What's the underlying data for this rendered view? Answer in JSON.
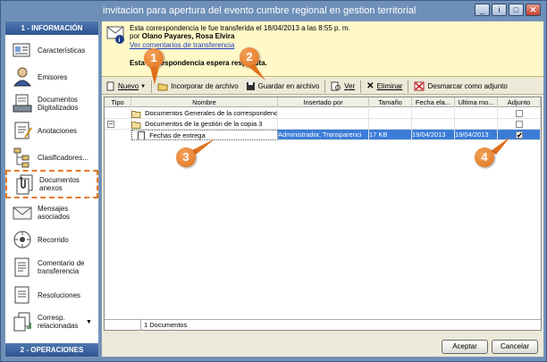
{
  "window": {
    "title": "invitacion para apertura del evento cumbre regional en gestion territorial",
    "buttons": [
      "_",
      "i",
      "□",
      "✕"
    ]
  },
  "sidebar": {
    "header": "1 - INFORMACIÓN",
    "footer": "2 - OPERACIONES",
    "items": [
      {
        "label": "Características",
        "icon": "card-icon"
      },
      {
        "label": "Emisores",
        "icon": "user-icon"
      },
      {
        "label": "Documentos Digitalizados",
        "icon": "scanner-icon"
      },
      {
        "label": "Anotaciones",
        "icon": "notes-icon"
      },
      {
        "label": "Clasificadores...",
        "icon": "tree-icon"
      },
      {
        "label": "Documentos anexos",
        "icon": "attachment-icon"
      },
      {
        "label": "Mensajes asociados",
        "icon": "envelope-icon"
      },
      {
        "label": "Recorrido",
        "icon": "route-icon"
      },
      {
        "label": "Comentario de transferencia",
        "icon": "comment-icon"
      },
      {
        "label": "Resoluciones",
        "icon": "resolution-icon"
      },
      {
        "label": "Corresp. relacionadas",
        "icon": "related-icon"
      }
    ]
  },
  "banner": {
    "line1": "Esta correspondencia le fue transferida el 18/04/2013 a las 8:55 p. m.",
    "line2_prefix": "por",
    "line2_name": "Olano Payares, Rosa Elvira",
    "link": "Ver comentarios de transferencia",
    "line4": "Esta correspondencia espera respuesta."
  },
  "toolbar": {
    "nuevo": "Nuevo",
    "incorporar": "Incorporar de archivo",
    "guardar": "Guardar en archivo",
    "ver": "Ver",
    "eliminar": "Eliminar",
    "desmarcar": "Desmarcar como adjunto"
  },
  "grid": {
    "columns": [
      "Tipo",
      "Nombre",
      "Insertado por",
      "Tamaño",
      "Fecha ela...",
      "Ultima mo...",
      "Adjunto"
    ],
    "rows": [
      {
        "expander": "",
        "name": "Documentos Generales de la correspondencia",
        "insertado": "",
        "tamano": "",
        "fecha": "",
        "ultima": "",
        "adjunto": false
      },
      {
        "expander": "–",
        "name": "Documentos de la gestión de la copia 3",
        "insertado": "",
        "tamano": "",
        "fecha": "",
        "ultima": "",
        "adjunto": false
      },
      {
        "expander": "",
        "name": "Fechas de entrega",
        "insertado": "Administrador, Transparenci",
        "tamano": "17 KB",
        "fecha": "19/04/2013",
        "ultima": "19/04/2013",
        "adjunto": true
      }
    ],
    "status": "1 Documentos"
  },
  "footer": {
    "accept": "Aceptar",
    "cancel": "Cancelar"
  },
  "callouts": [
    "1",
    "2",
    "3",
    "4"
  ],
  "colors": {
    "callout": "#e0701c",
    "selection": "#3b7cd8",
    "banner": "#fff8c8",
    "highlight_dash": "#e87722"
  }
}
